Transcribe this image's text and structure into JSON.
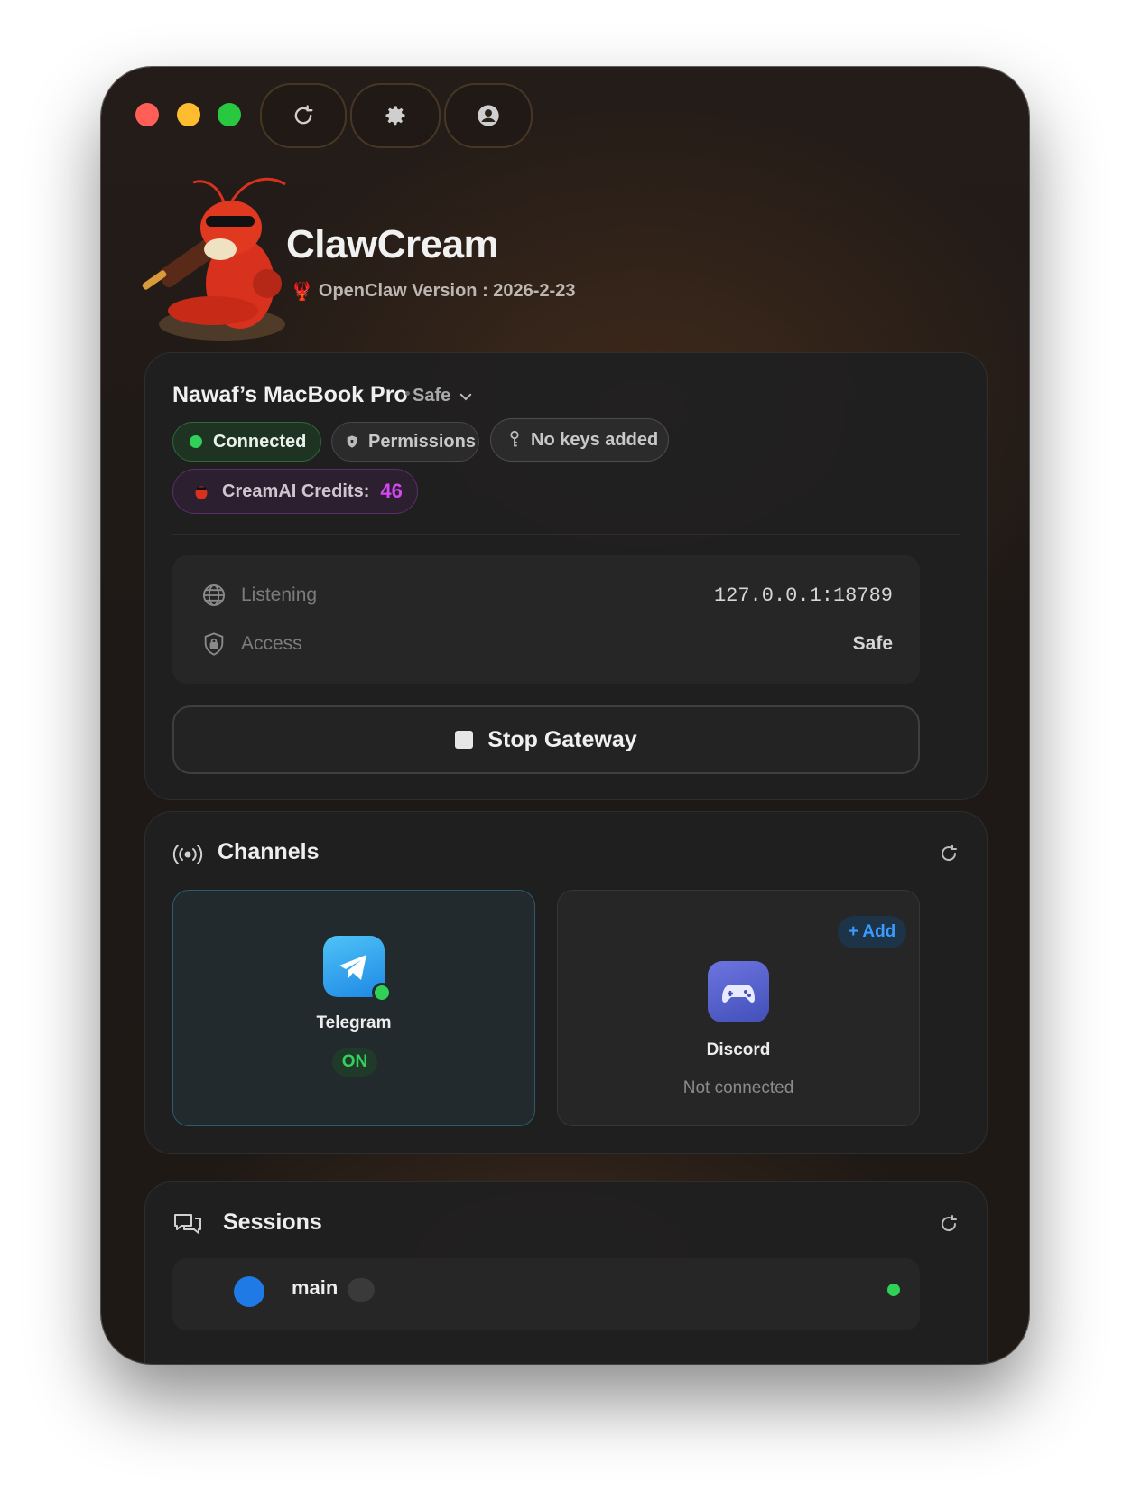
{
  "app": {
    "title": "ClawCream",
    "version_label": "OpenClaw Version : 2026-2-23"
  },
  "toolbar": {
    "buttons": [
      "refresh-icon",
      "gear-icon",
      "user-icon"
    ]
  },
  "device": {
    "name": "Nawaf’s MacBook Pro",
    "mode": "Safe",
    "status": "Connected",
    "permissions_label": "Permissions",
    "keys_label": "No keys added",
    "credits_label": "CreamAI Credits:",
    "credits_value": "46",
    "listening_label": "Listening",
    "listening_value": "127.0.0.1:18789",
    "access_label": "Access",
    "access_value": "Safe",
    "stop_label": "Stop Gateway"
  },
  "channels": {
    "title": "Channels",
    "items": [
      {
        "name": "Telegram",
        "status": "ON"
      },
      {
        "name": "Discord",
        "status": "Not connected",
        "action": "+ Add"
      }
    ]
  },
  "sessions": {
    "title": "Sessions",
    "first_row_name": "main"
  },
  "colors": {
    "connected_green": "#30d158",
    "credits_purple": "#d147f0",
    "add_blue": "#3b9cff"
  }
}
